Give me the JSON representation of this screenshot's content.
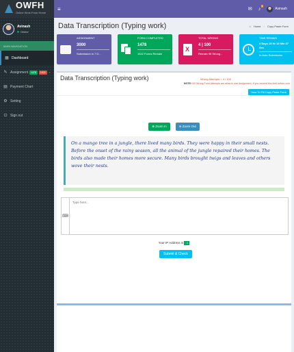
{
  "brand": {
    "name": "OWFH",
    "tagline": "Online Work From Home"
  },
  "user": {
    "name": "Avinash",
    "status": "Online"
  },
  "sidebar": {
    "section_label": "MAIN NAVIGATION",
    "items": [
      {
        "label": "Dashboard",
        "icon": "dashboard-icon",
        "active": true
      },
      {
        "label": "Assignment",
        "icon": "edit-icon",
        "badges": [
          "1478",
          "1522"
        ]
      },
      {
        "label": "Payment Chart",
        "icon": "table-icon"
      },
      {
        "label": "Setting",
        "icon": "gear-icon"
      },
      {
        "label": "Sign out",
        "icon": "power-icon"
      }
    ]
  },
  "topbar": {
    "notification_count": "1",
    "user_name": "Avinash"
  },
  "page": {
    "title": "Data Transcription (Typing work)",
    "breadcrumb": [
      "Home",
      "Copy Paste Form"
    ]
  },
  "info_boxes": [
    {
      "label": "ASSIGNMENT",
      "value": "3000",
      "desc": "Submission in 7 D...",
      "color": "#605ca8",
      "icon": "folder-icon"
    },
    {
      "label": "FORM COMPLETED",
      "value": "1478",
      "desc": "1522 Forms Remain",
      "color": "#00a65a",
      "icon": "copy-icon"
    },
    {
      "label": "TOTAL WRONG",
      "value": "4 | 100",
      "desc": "Remain 96 Wrong...",
      "color": "#d81b60",
      "icon": "x-file-icon"
    },
    {
      "label": "TIME REMAIN",
      "value": "4 Days 15 Hr 19 Min 37 Sec",
      "desc": "In Auto Submission",
      "color": "#00c0ef",
      "icon": "clock-icon"
    }
  ],
  "panel": {
    "title": "Data Transcription (Typing work)",
    "wrong_attempts": "Wrong Attempts = 4 / 100",
    "note_label": "NOTE:",
    "note_text": "100 Wrong Form Attempts are allow in one Assignment, If you exceed this limit before com",
    "howto_button": "How To Fill Copy Paste Form",
    "zoom_in": "Zoom In",
    "zoom_out": "Zoom Out",
    "passage": "On a mango tree in a jungle, there lived many birds. They were happy in their small nests. Before the onset of the rainy season, all the animal of the jungle repaired their homes. The birds also made their homes more secure. Many birds brought twigs and leaves and others wove their nests.",
    "input_placeholder": "Type here...",
    "ip_label": "Your IP Address is",
    "ip_value": "::1",
    "submit_label": "Submit & Check"
  },
  "colors": {
    "topbar": "#605ca8",
    "sidebar": "#222d32",
    "accent": "#3c8dbc"
  }
}
